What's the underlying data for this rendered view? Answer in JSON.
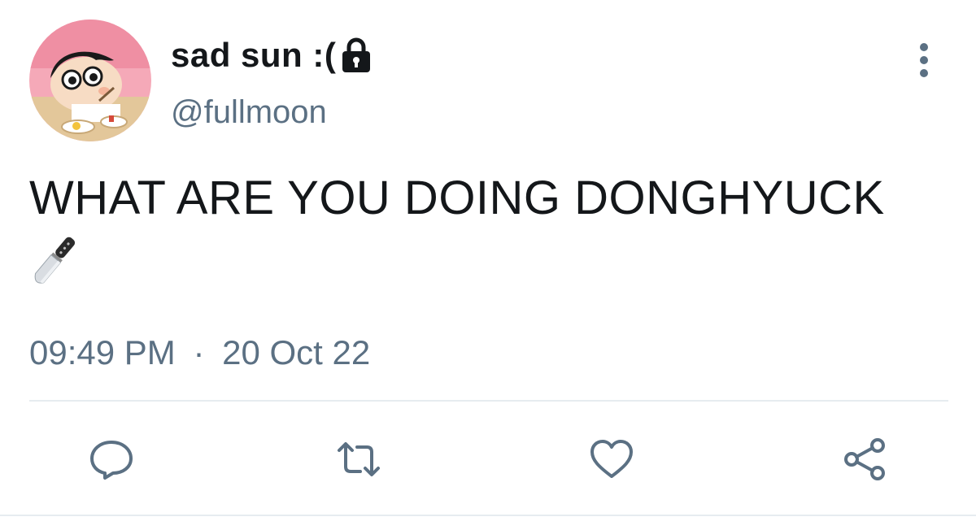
{
  "tweet": {
    "display_name": "sad sun :(",
    "handle": "@fullmoon",
    "text": "WHAT ARE YOU DOING DONGHYUCK",
    "emoji": "knife",
    "time": "09:49 PM",
    "separator": "·",
    "date": "20 Oct 22",
    "protected": true
  },
  "icons": {
    "lock": "lock-icon",
    "more": "more-vertical-icon",
    "reply": "reply-icon",
    "retweet": "retweet-icon",
    "like": "heart-icon",
    "share": "share-icon",
    "emoji": "knife-emoji-icon"
  },
  "colors": {
    "text": "#14171a",
    "secondary": "#5b7083",
    "divider": "#e6ecf0"
  }
}
